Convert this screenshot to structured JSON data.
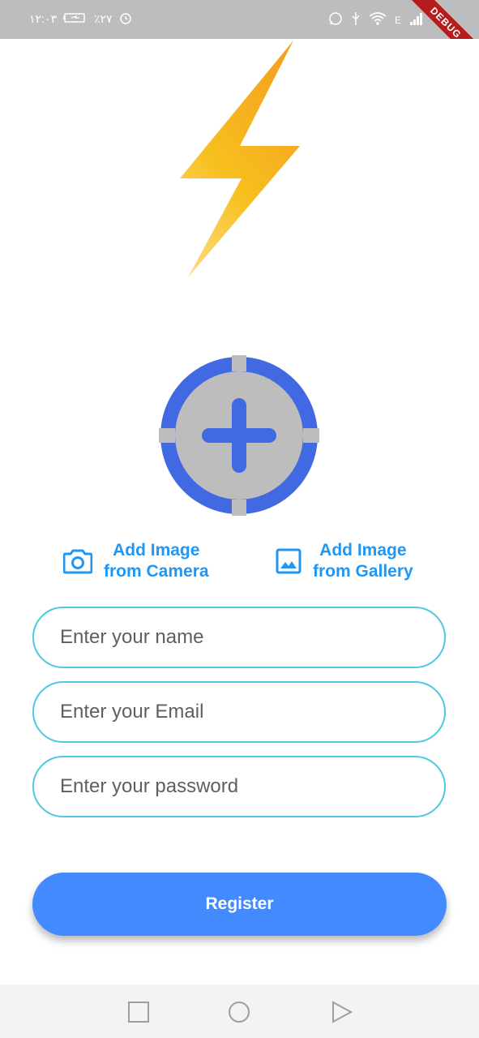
{
  "status_bar": {
    "time": "١٢:٠٣",
    "battery": "٪٢٧",
    "signal_label": "E",
    "debug_label": "DEBUG",
    "icons": [
      "alarm-icon",
      "battery-icon",
      "whatsapp-icon",
      "usb-icon",
      "wifi-icon",
      "signal-icon"
    ]
  },
  "avatar": {
    "icon": "add-circle-icon",
    "ring_color": "#4169e1",
    "fill_color": "#bdbdbd"
  },
  "actions": {
    "camera_line1": "Add Image",
    "camera_line2": "from Camera",
    "gallery_line1": "Add Image",
    "gallery_line2": "from Gallery",
    "accent": "#2196f3"
  },
  "form": {
    "name_placeholder": "Enter your name",
    "email_placeholder": "Enter your Email",
    "password_placeholder": "Enter your password",
    "name_value": "",
    "email_value": "",
    "password_value": "",
    "border_color": "#4cc9e0"
  },
  "register": {
    "label": "Register",
    "color": "#448aff"
  },
  "nav": {
    "icons": [
      "recents-square-icon",
      "home-circle-icon",
      "back-triangle-icon"
    ]
  }
}
